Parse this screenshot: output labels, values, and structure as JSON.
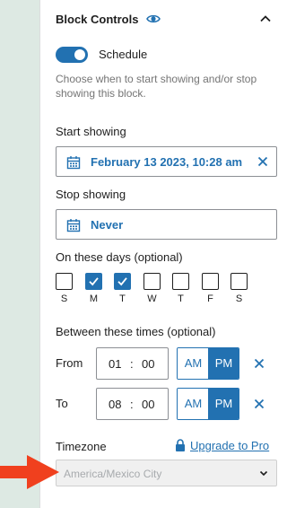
{
  "panel": {
    "title": "Block Controls",
    "eye_icon": "eye-icon",
    "collapse_icon": "chevron-up-icon"
  },
  "schedule": {
    "toggle_on": true,
    "label": "Schedule",
    "help": "Choose when to start showing and/or stop showing this block."
  },
  "start": {
    "label": "Start showing",
    "value": "February 13 2023, 10:28 am"
  },
  "stop": {
    "label": "Stop showing",
    "value": "Never"
  },
  "days": {
    "label": "On these days (optional)",
    "items": [
      {
        "letter": "S",
        "checked": false
      },
      {
        "letter": "M",
        "checked": true
      },
      {
        "letter": "T",
        "checked": true
      },
      {
        "letter": "W",
        "checked": false
      },
      {
        "letter": "T",
        "checked": false
      },
      {
        "letter": "F",
        "checked": false
      },
      {
        "letter": "S",
        "checked": false
      }
    ]
  },
  "times": {
    "label": "Between these times (optional)",
    "from": {
      "label": "From",
      "hour": "01",
      "sep": ":",
      "minute": "00",
      "am": "AM",
      "pm": "PM",
      "selected": "PM"
    },
    "to": {
      "label": "To",
      "hour": "08",
      "sep": ":",
      "minute": "00",
      "am": "AM",
      "pm": "PM",
      "selected": "PM"
    }
  },
  "timezone": {
    "label": "Timezone",
    "upgrade": "Upgrade to Pro",
    "value": "America/Mexico City"
  },
  "colors": {
    "accent": "#2271b1",
    "arrow": "#f0401e",
    "strip": "#dde9e3"
  }
}
